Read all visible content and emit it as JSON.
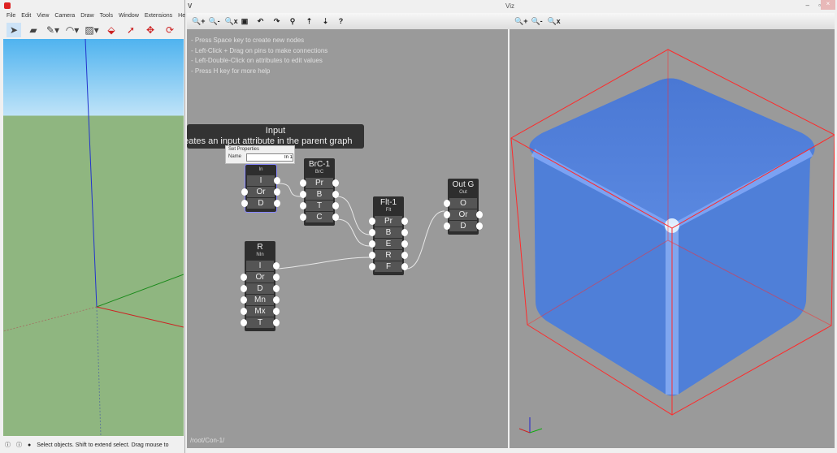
{
  "sketchup": {
    "menu": [
      "File",
      "Edit",
      "View",
      "Camera",
      "Draw",
      "Tools",
      "Window",
      "Extensions",
      "Help"
    ],
    "tools": [
      {
        "icon": "select-arrow-icon",
        "g": "➤"
      },
      {
        "icon": "eraser-icon",
        "g": "▰"
      },
      {
        "icon": "pencil-icon",
        "g": "✎▾"
      },
      {
        "icon": "arc-icon",
        "g": "◠▾"
      },
      {
        "icon": "shape-icon",
        "g": "▨▾"
      },
      {
        "icon": "push-pull-icon",
        "g": "⬙"
      },
      {
        "icon": "follow-me-icon",
        "g": "➚"
      },
      {
        "icon": "move-icon",
        "g": "✥"
      },
      {
        "icon": "rotate-icon",
        "g": "⟳"
      }
    ],
    "status": "Select objects. Shift to extend select. Drag mouse to"
  },
  "viz": {
    "title": "Viz",
    "path": "/root/Con-1/",
    "toolbar": [
      {
        "icon": "zoom-in-icon",
        "g": "🔍+"
      },
      {
        "icon": "zoom-out-icon",
        "g": "🔍-"
      },
      {
        "icon": "zoom-reset-icon",
        "g": "🔍x"
      },
      {
        "icon": "frame-icon",
        "g": "▣"
      },
      {
        "icon": "undo-icon",
        "g": "↶"
      },
      {
        "icon": "redo-icon",
        "g": "↷"
      },
      {
        "icon": "search-icon",
        "g": "⚲"
      },
      {
        "icon": "push-up-icon",
        "g": "⇡"
      },
      {
        "icon": "push-down-icon",
        "g": "⇣"
      },
      {
        "icon": "help-icon",
        "g": "?"
      }
    ],
    "view_toolbar": [
      {
        "icon": "zoom-in-icon",
        "g": "🔍+"
      },
      {
        "icon": "zoom-out-icon",
        "g": "🔍-"
      },
      {
        "icon": "zoom-reset-icon",
        "g": "🔍x"
      }
    ],
    "help": [
      "- Press Space key to create new nodes",
      "- Left-Click + Drag on pins to make connections",
      "- Left-Double-Click on attributes to edit values",
      "- Press H key for more help"
    ],
    "tooltip": {
      "title": "Input",
      "desc": "Creates an input attribute in the parent graph"
    },
    "set_properties": {
      "title": "Set Properties",
      "label": "Name",
      "value": "In 1"
    },
    "nodes": [
      {
        "id": "in",
        "title": "",
        "type": "In",
        "rows": [
          "I",
          "Or",
          "D"
        ]
      },
      {
        "id": "brc",
        "title": "BrC-1",
        "type": "BrC",
        "rows": [
          "Pr",
          "B",
          "T",
          "C"
        ]
      },
      {
        "id": "flt",
        "title": "Flt-1",
        "type": "Flt",
        "rows": [
          "Pr",
          "B",
          "E",
          "R",
          "F"
        ]
      },
      {
        "id": "out",
        "title": "Out G",
        "type": "Out",
        "rows": [
          "O",
          "Or",
          "D"
        ]
      },
      {
        "id": "r",
        "title": "R",
        "type": "NIn",
        "rows": [
          "I",
          "Or",
          "D",
          "Mn",
          "Mx",
          "T"
        ]
      }
    ],
    "colors": {
      "canvas": "#9a9a9a",
      "node": "#2e2e2e",
      "cube": "#4f7fd8",
      "bbox": "#ff2020"
    }
  }
}
